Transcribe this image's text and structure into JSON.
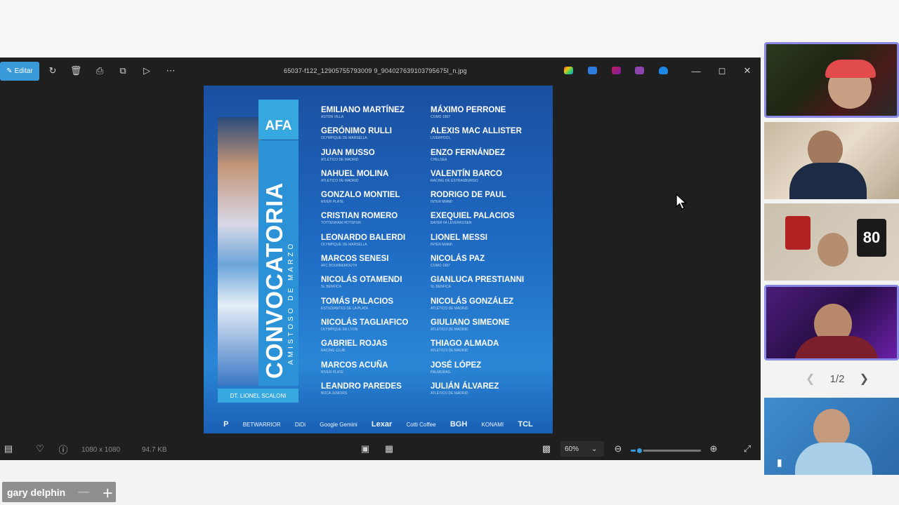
{
  "toolbar": {
    "edit_label": "Editar",
    "filename": "65037-f122_12905755793009 9_904027639103795675I_n.jpg",
    "icons": [
      "rotate-icon",
      "trash-icon",
      "print-icon",
      "share-icon",
      "slideshow-icon",
      "more-icon"
    ],
    "window_controls": [
      "minimize",
      "maximize",
      "close"
    ]
  },
  "poster": {
    "badge": "AFA",
    "title": "CONVOCATORIA",
    "subtitle": "AMISTOSO DE MARZO",
    "coach": "DT. LIONEL SCALONI",
    "left_column": [
      {
        "name": "EMILIANO MARTÍNEZ",
        "club": "ASTON VILLA"
      },
      {
        "name": "GERÓNIMO RULLI",
        "club": "OLYMPIQUE DE MARSELLA"
      },
      {
        "name": "JUAN MUSSO",
        "club": "ATLÉTICO DE MADRID"
      },
      {
        "name": "NAHUEL MOLINA",
        "club": "ATLÉTICO DE MADRID"
      },
      {
        "name": "GONZALO MONTIEL",
        "club": "RIVER PLATE"
      },
      {
        "name": "CRISTIAN ROMERO",
        "club": "TOTTENHAM HOTSPUR"
      },
      {
        "name": "LEONARDO BALERDI",
        "club": "OLYMPIQUE DE MARSELLA"
      },
      {
        "name": "MARCOS SENESI",
        "club": "AFC BOURNEMOUTH"
      },
      {
        "name": "NICOLÁS OTAMENDI",
        "club": "SL BENFICA"
      },
      {
        "name": "TOMÁS PALACIOS",
        "club": "ESTUDIANTES DE LA PLATA"
      },
      {
        "name": "NICOLÁS TAGLIAFICO",
        "club": "OLYMPIQUE DE LYON"
      },
      {
        "name": "GABRIEL ROJAS",
        "club": "RACING CLUB"
      },
      {
        "name": "MARCOS ACUÑA",
        "club": "RIVER PLATE"
      },
      {
        "name": "LEANDRO PAREDES",
        "club": "BOCA JUNIORS"
      }
    ],
    "right_column": [
      {
        "name": "MÁXIMO PERRONE",
        "club": "COMO 1907"
      },
      {
        "name": "ALEXIS MAC ALLISTER",
        "club": "LIVERPOOL"
      },
      {
        "name": "ENZO FERNÁNDEZ",
        "club": "CHELSEA"
      },
      {
        "name": "VALENTÍN BARCO",
        "club": "RACING DE ESTRASBURGO"
      },
      {
        "name": "RODRIGO DE PAUL",
        "club": "INTER MIAMI"
      },
      {
        "name": "EXEQUIEL PALACIOS",
        "club": "BAYER 04 LEVERKUSEN"
      },
      {
        "name": "LIONEL MESSI",
        "club": "INTER MIAMI"
      },
      {
        "name": "NICOLÁS PAZ",
        "club": "COMO 1907"
      },
      {
        "name": "GIANLUCA PRESTIANNI",
        "club": "SL BENFICA"
      },
      {
        "name": "NICOLÁS GONZÁLEZ",
        "club": "ATLÉTICO DE MADRID"
      },
      {
        "name": "GIULIANO SIMEONE",
        "club": "ATLÉTICO DE MADRID"
      },
      {
        "name": "THIAGO ALMADA",
        "club": "ATLÉTICO DE MADRID"
      },
      {
        "name": "JOSÉ LÓPEZ",
        "club": "PALMEIRAS"
      },
      {
        "name": "JULIÁN ÁLVAREZ",
        "club": "ATLÉTICO DE MADRID"
      }
    ],
    "sponsors": [
      "P",
      "BETWARRIOR",
      "DiDi",
      "Google Gemini",
      "Lexar",
      "Cotti Coffee",
      "BGH",
      "KONAMI",
      "TCL"
    ]
  },
  "bottombar": {
    "dimensions": "1080 x 1080",
    "filesize": "94.7 KB",
    "zoom": "60%",
    "zoom_level": 0.12
  },
  "tiles": {
    "pager": "1/2"
  },
  "name_overlay": {
    "name": "gary delphin"
  },
  "colors": {
    "accent": "#3a9ad9",
    "active_tile": "#8a89e6",
    "viewer_bg": "#1f1f1f",
    "poster_blue": "#1e6ac3"
  }
}
